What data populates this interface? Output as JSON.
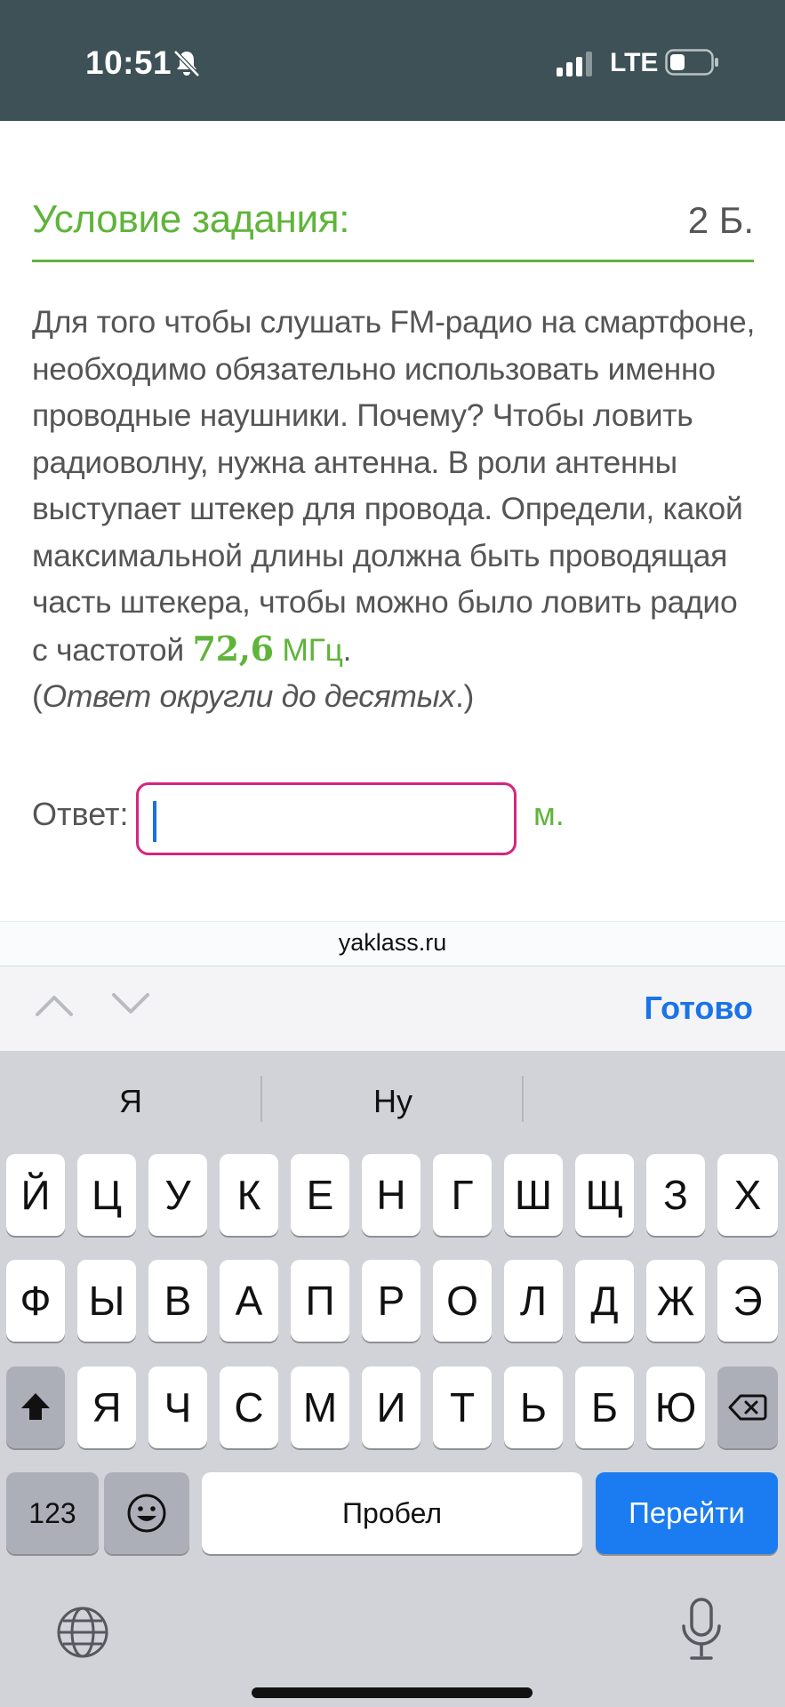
{
  "status_bar": {
    "time": "10:51",
    "network": "LTE",
    "icons": [
      "bell-slash-icon",
      "signal-icon",
      "battery-icon"
    ],
    "background": "#3d5157"
  },
  "task": {
    "header_title": "Условие задания:",
    "points": "2 Б.",
    "lines": [
      "Для того чтобы слушать FM-радио на смартфоне,",
      "необходимо обязательно использовать именно",
      "проводные наушники. Почему? Чтобы ловить",
      "радиоволну, нужна антенна. В роли антенны",
      "выступает штекер для провода. Определи, какой",
      "максимальной длины должна быть проводящая",
      "часть штекера, чтобы можно было ловить радио"
    ],
    "freq_prefix": "с частотой",
    "freq_value": "72,6",
    "freq_unit": "МГц",
    "freq_suffix": ".",
    "note_open": "(",
    "note_text": "Ответ округли до десятых",
    "note_close": ".)",
    "accent_color": "#5fb43a"
  },
  "answer": {
    "label": "Ответ:",
    "value": "",
    "unit": "м.",
    "border_color": "#d6257e"
  },
  "browser": {
    "address": "yaklass.ru"
  },
  "accessory": {
    "done_label": "Готово",
    "icons": [
      "chevron-up-icon",
      "chevron-down-icon"
    ]
  },
  "keyboard": {
    "suggestions": [
      "Я",
      "Ну",
      ""
    ],
    "row1": [
      "Й",
      "Ц",
      "У",
      "К",
      "Е",
      "Н",
      "Г",
      "Ш",
      "Щ",
      "З",
      "Х"
    ],
    "row2": [
      "Ф",
      "Ы",
      "В",
      "А",
      "П",
      "Р",
      "О",
      "Л",
      "Д",
      "Ж",
      "Э"
    ],
    "row3": [
      "Я",
      "Ч",
      "С",
      "М",
      "И",
      "Т",
      "Ь",
      "Б",
      "Ю"
    ],
    "numbers_label": "123",
    "space_label": "Пробел",
    "go_label": "Перейти",
    "icons": [
      "shift-icon",
      "backspace-icon",
      "emoji-icon",
      "globe-icon",
      "microphone-icon"
    ]
  }
}
